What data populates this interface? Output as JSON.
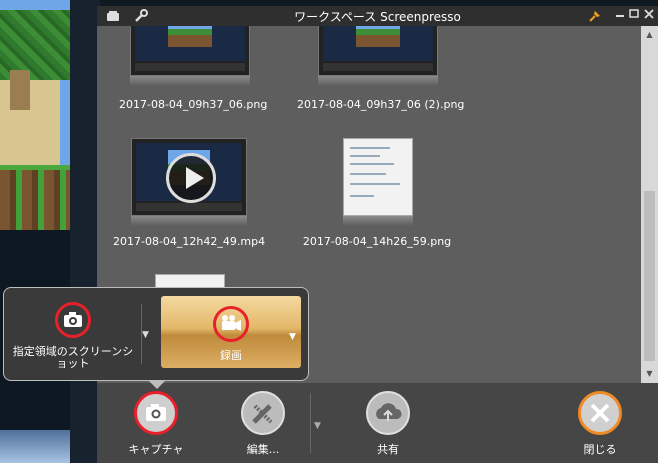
{
  "window": {
    "title": "ワークスペース Screenpresso"
  },
  "files": [
    {
      "name": "2017-08-04_09h37_06.png"
    },
    {
      "name": "2017-08-04_09h37_06 (2).png"
    },
    {
      "name": "2017-08-04_12h42_49.mp4"
    },
    {
      "name": "2017-08-04_14h26_59.png"
    }
  ],
  "popup": {
    "region_label": "指定領域のスクリーンショット",
    "record_label": "録画"
  },
  "toolbar": {
    "capture_label": "キャプチャ",
    "edit_label": "編集...",
    "share_label": "共有",
    "close_label": "閉じる"
  }
}
